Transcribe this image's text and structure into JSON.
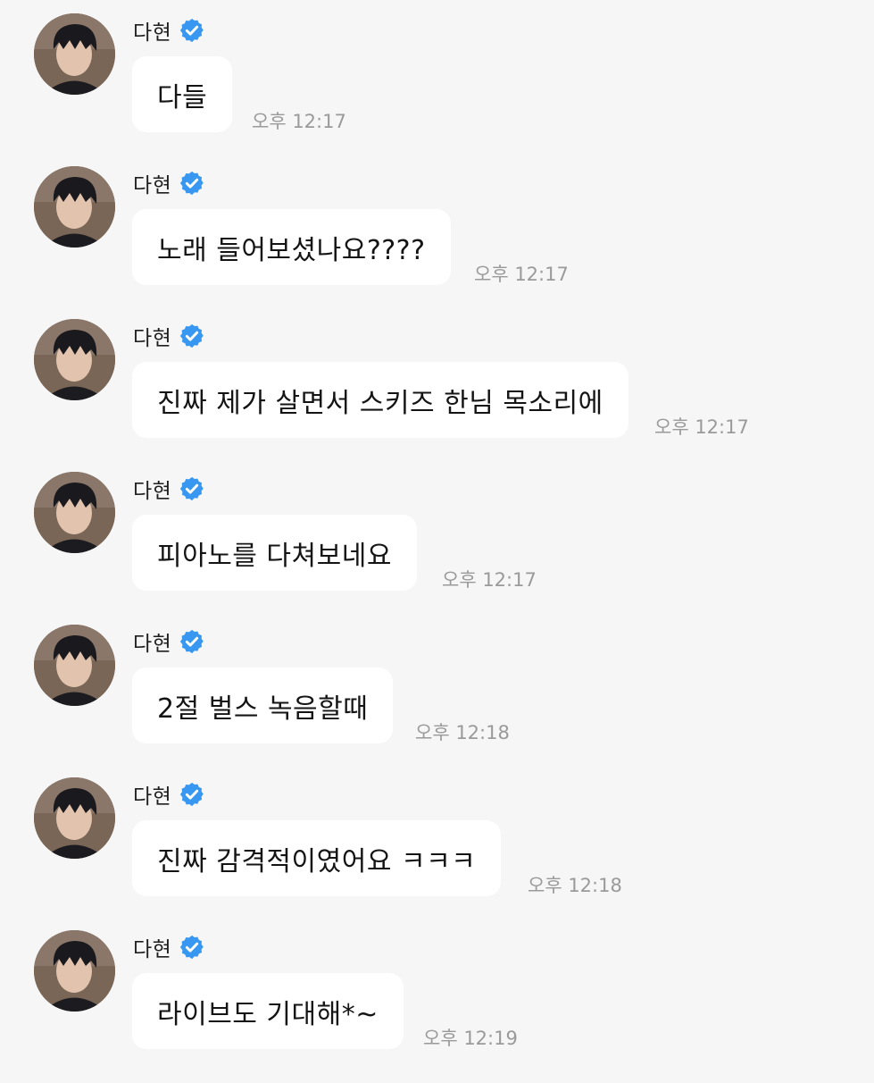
{
  "colors": {
    "background": "#f6f6f6",
    "bubble": "#ffffff",
    "verified_badge": "#3897f0",
    "timestamp": "#9a9a9a"
  },
  "messages": [
    {
      "sender": "다현",
      "verified_icon": "verified-badge-icon",
      "text": "다들",
      "time": "오후 12:17"
    },
    {
      "sender": "다현",
      "verified_icon": "verified-badge-icon",
      "text": "노래 들어보셨나요????",
      "time": "오후 12:17"
    },
    {
      "sender": "다현",
      "verified_icon": "verified-badge-icon",
      "text": "진짜 제가 살면서 스키즈 한님 목소리에",
      "time": "오후 12:17"
    },
    {
      "sender": "다현",
      "verified_icon": "verified-badge-icon",
      "text": "피아노를 다쳐보네요",
      "time": "오후 12:17"
    },
    {
      "sender": "다현",
      "verified_icon": "verified-badge-icon",
      "text": "2절 벌스 녹음할때",
      "time": "오후 12:18"
    },
    {
      "sender": "다현",
      "verified_icon": "verified-badge-icon",
      "text": "진짜 감격적이였어요 ㅋㅋㅋ",
      "time": "오후 12:18"
    },
    {
      "sender": "다현",
      "verified_icon": "verified-badge-icon",
      "text": "라이브도 기대해*~",
      "time": "오후 12:19"
    }
  ]
}
